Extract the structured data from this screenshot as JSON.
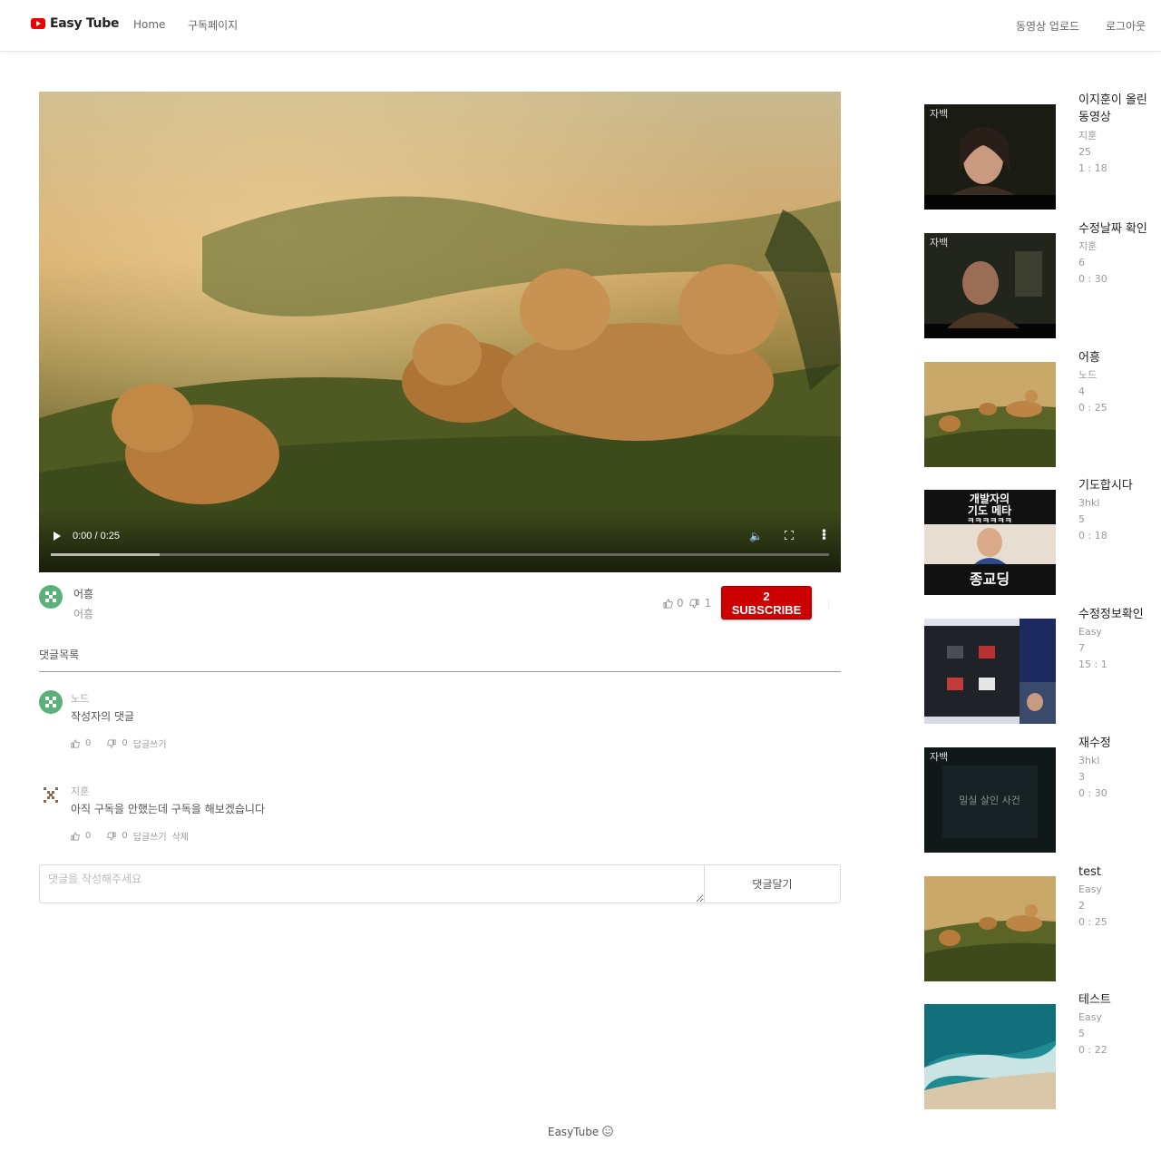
{
  "header": {
    "logo_text": "Easy Tube",
    "nav": {
      "home": "Home",
      "subscriptions": "구독페이지"
    },
    "upload": "동영상 업로드",
    "logout": "로그아웃"
  },
  "player": {
    "time": "0:00 / 0:25",
    "progress": 0.14
  },
  "video": {
    "uploader": "어흥",
    "description": "어흥",
    "likes": "0",
    "dislikes": "1",
    "subscribe_label": "2 SUBSCRIBE"
  },
  "comments": {
    "title": "댓글목록",
    "items": [
      {
        "author": "노드",
        "text": "작성자의 댓글",
        "likes": "0",
        "dislikes": "0",
        "reply": "답글쓰기"
      },
      {
        "author": "지훈",
        "text": "아직 구독을 안했는데 구독을 해보겠습니다",
        "likes": "0",
        "dislikes": "0",
        "reply": "답글쓰기",
        "delete": "삭제"
      }
    ],
    "input_placeholder": "댓글을 작성해주세요",
    "submit_label": "댓글달기"
  },
  "sidebar": {
    "items": [
      {
        "title": "이지훈이 올린 동영상",
        "author": "지훈",
        "views": "25",
        "duration": "1 : 18",
        "thumb": "drama-woman"
      },
      {
        "title": "수정날짜 확인",
        "author": "지훈",
        "views": "6",
        "duration": "0 : 30",
        "thumb": "drama-man"
      },
      {
        "title": "어흥",
        "author": "노드",
        "views": "4",
        "duration": "0 : 25",
        "thumb": "lions"
      },
      {
        "title": "기도합시다",
        "author": "3hkl",
        "views": "5",
        "duration": "0 : 18",
        "thumb": "meme"
      },
      {
        "title": "수정정보확인",
        "author": "Easy",
        "views": "7",
        "duration": "15 : 1",
        "thumb": "screen"
      },
      {
        "title": "재수정",
        "author": "3hkl",
        "views": "3",
        "duration": "0 : 30",
        "thumb": "dark-title"
      },
      {
        "title": "test",
        "author": "Easy",
        "views": "2",
        "duration": "0 : 25",
        "thumb": "lions"
      },
      {
        "title": "테스트",
        "author": "Easy",
        "views": "5",
        "duration": "0 : 22",
        "thumb": "ocean"
      }
    ],
    "thumb_texts": {
      "drama_mark": "자백",
      "meme_line1": "개발자의",
      "meme_line2": "기도 메타",
      "meme_line3": "ㅋㅋㅋㅋㅋㅋ",
      "meme_bottom": "종교딩",
      "dark_title": "밀실 살인 사건"
    }
  },
  "footer": {
    "text": "EasyTube",
    "icon": "smile-icon"
  }
}
